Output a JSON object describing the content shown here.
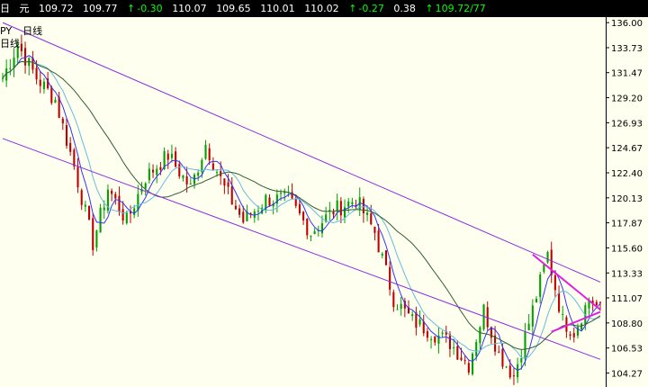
{
  "quote_bar": {
    "period": "日",
    "currency": "元",
    "open": "109.72",
    "close": "109.77",
    "change": "-0.30",
    "high": "110.07",
    "low": "109.65",
    "v1": "110.01",
    "v2": "110.02",
    "change2": "-0.27",
    "ratio": "0.38",
    "bidask": "109.72/77",
    "up_arrow": "↑"
  },
  "symbol_label": {
    "symbol": "PY",
    "period": "日线",
    "sub": "日线"
  },
  "colors": {
    "background": "#fffff0",
    "up_candle": "#00a000",
    "down_candle": "#c00000",
    "channel": "#8a2be2",
    "triangle": "#e020e0",
    "ma_fast": "#3333ff",
    "ma_mid": "#66bbdd",
    "ma_slow": "#2f5f2f",
    "axis_text": "#000000"
  },
  "chart_data": {
    "type": "candlestick",
    "yticks": [
      "136.00",
      "133.73",
      "131.47",
      "129.20",
      "126.93",
      "124.67",
      "122.40",
      "120.13",
      "117.87",
      "115.60",
      "113.33",
      "111.07",
      "108.80",
      "106.53",
      "104.27"
    ],
    "ylim": [
      103.0,
      136.5
    ],
    "bars": 160,
    "anchors": [
      [
        0,
        131
      ],
      [
        4,
        134
      ],
      [
        9,
        131
      ],
      [
        14,
        129
      ],
      [
        19,
        123
      ],
      [
        24,
        116
      ],
      [
        28,
        121
      ],
      [
        33,
        118
      ],
      [
        38,
        122
      ],
      [
        44,
        124
      ],
      [
        50,
        121
      ],
      [
        54,
        125
      ],
      [
        59,
        121
      ],
      [
        64,
        118
      ],
      [
        70,
        120
      ],
      [
        76,
        120
      ],
      [
        82,
        117
      ],
      [
        88,
        119
      ],
      [
        94,
        120
      ],
      [
        99,
        117
      ],
      [
        104,
        111
      ],
      [
        109,
        109
      ],
      [
        114,
        108
      ],
      [
        119,
        107
      ],
      [
        124,
        105
      ],
      [
        128,
        110
      ],
      [
        132,
        106
      ],
      [
        136,
        104
      ],
      [
        141,
        110
      ],
      [
        145,
        115
      ],
      [
        149,
        109
      ],
      [
        152,
        108
      ],
      [
        156,
        111
      ],
      [
        159,
        110
      ]
    ],
    "channel_upper": [
      [
        0,
        136
      ],
      [
        159,
        112.5
      ]
    ],
    "channel_lower": [
      [
        0,
        125.5
      ],
      [
        159,
        105.5
      ]
    ],
    "triangle": [
      [
        141,
        115
      ],
      [
        159,
        110
      ],
      [
        146,
        108
      ],
      [
        159,
        109.8
      ]
    ]
  }
}
